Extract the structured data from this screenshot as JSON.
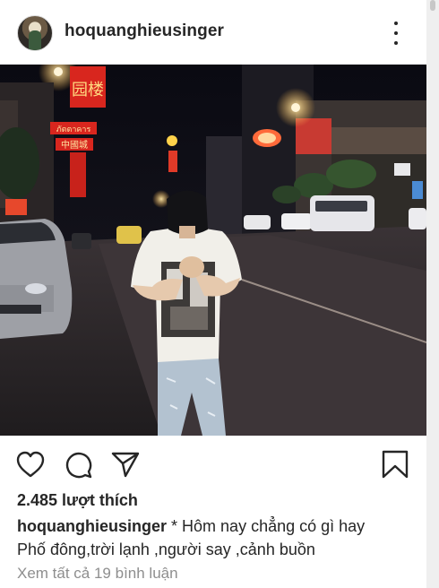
{
  "header": {
    "username": "hoquanghieusinger",
    "more_icon": "more-vertical-icon"
  },
  "photo": {
    "signs": {
      "top_hanzi": "园楼",
      "restaurant_thai": "ภัตตาคาร",
      "china_town_hanzi": "中國城"
    }
  },
  "actions": {
    "like_icon": "heart-icon",
    "comment_icon": "comment-icon",
    "share_icon": "share-icon",
    "save_icon": "bookmark-icon"
  },
  "likes": "2.485 lượt thích",
  "caption": {
    "user": "hoquanghieusinger",
    "line1": "* Hôm nay chẳng có gì hay",
    "line2": "Phố đông,trời lạnh ,người say ,cảnh buồn"
  },
  "comments_link": "Xem tất cả 19 bình luận",
  "colors": {
    "text": "#262626",
    "muted": "#8e8e8e",
    "sign_red": "#d8261e",
    "street_light": "#ffd27a"
  }
}
